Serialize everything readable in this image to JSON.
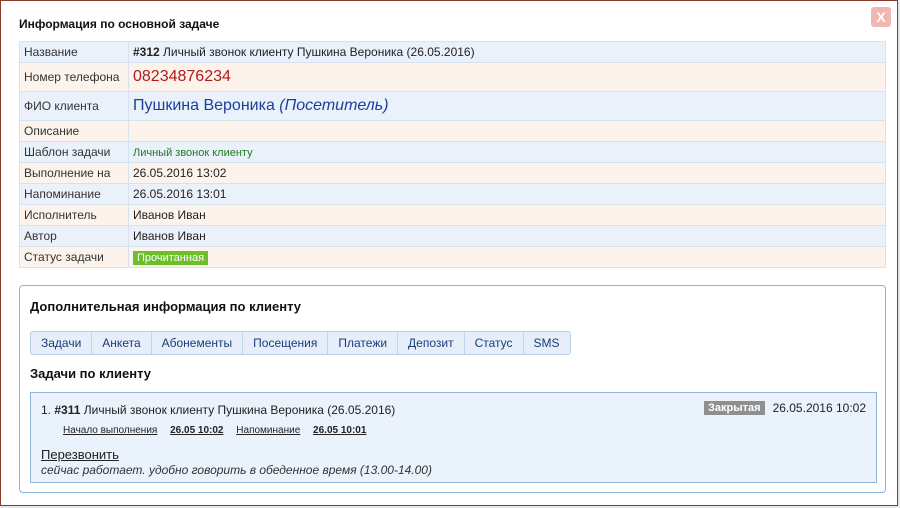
{
  "dialog": {
    "title": "Информация по основной задаче",
    "close_label": "X"
  },
  "info": {
    "rows": [
      {
        "label": "Название",
        "task_id": "#312",
        "value": "Личный звонок клиенту Пушкина Вероника (26.05.2016)"
      },
      {
        "label": "Номер телефона",
        "value": "08234876234"
      },
      {
        "label": "ФИО клиента",
        "name": "Пушкина Вероника",
        "role": "(Посетитель)"
      },
      {
        "label": "Описание",
        "value": ""
      },
      {
        "label": "Шаблон задачи",
        "value": "Личный звонок клиенту"
      },
      {
        "label": "Выполнение на",
        "value": "26.05.2016 13:02"
      },
      {
        "label": "Напоминание",
        "value": "26.05.2016 13:01"
      },
      {
        "label": "Исполнитель",
        "value": "Иванов Иван"
      },
      {
        "label": "Автор",
        "value": "Иванов Иван"
      },
      {
        "label": "Статус задачи",
        "value": "Прочитанная"
      }
    ]
  },
  "extra": {
    "title": "Дополнительная информация по клиенту",
    "tabs": [
      "Задачи",
      "Анкета",
      "Абонементы",
      "Посещения",
      "Платежи",
      "Депозит",
      "Статус",
      "SMS"
    ],
    "section_title": "Задачи по клиенту",
    "task": {
      "index": "1.",
      "id": "#311",
      "title": "Личный звонок клиенту Пушкина Вероника (26.05.2016)",
      "status": "Закрытая",
      "datetime": "26.05.2016 10:02",
      "start_label": "Начало выполнения",
      "start_value": "26.05 10:02",
      "reminder_label": "Напоминание",
      "reminder_value": "26.05 10:01",
      "action": "Перезвонить",
      "note": "сейчас работает. удобно говорить в обеденное время (13.00-14.00)"
    }
  },
  "colors": {
    "status_green": "#6bbf2b",
    "phone_red": "#b01a1a",
    "name_blue": "#1d3f9a",
    "closed_gray": "#8f8f8f"
  }
}
